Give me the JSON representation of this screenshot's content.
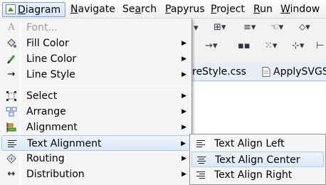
{
  "menubar": {
    "items": [
      {
        "label": "Diagram",
        "mnemonic": "D"
      },
      {
        "label": "Navigate",
        "mnemonic": "N"
      },
      {
        "label": "Search",
        "mnemonic": "a"
      },
      {
        "label": "Papyrus",
        "mnemonic": "P"
      },
      {
        "label": "Project",
        "mnemonic": "P"
      },
      {
        "label": "Run",
        "mnemonic": "R"
      },
      {
        "label": "Window",
        "mnemonic": "W"
      }
    ]
  },
  "background": {
    "tabs": [
      "reStyle.css",
      "ApplySVGS"
    ]
  },
  "menu": {
    "items": [
      {
        "label": "Font...",
        "icon": "font-icon",
        "disabled": true,
        "submenu": false
      },
      {
        "label": "Fill Color",
        "icon": "fill-color-icon",
        "disabled": false,
        "submenu": true
      },
      {
        "label": "Line Color",
        "icon": "line-color-icon",
        "disabled": false,
        "submenu": true
      },
      {
        "label": "Line Style",
        "icon": "line-style-icon",
        "disabled": false,
        "submenu": true
      },
      {
        "label": "Select",
        "icon": "select-icon",
        "disabled": false,
        "submenu": true
      },
      {
        "label": "Arrange",
        "icon": "arrange-icon",
        "disabled": false,
        "submenu": true
      },
      {
        "label": "Alignment",
        "icon": "alignment-icon",
        "disabled": false,
        "submenu": true
      },
      {
        "label": "Text Alignment",
        "icon": "text-alignment-icon",
        "disabled": false,
        "submenu": true,
        "highlighted": true
      },
      {
        "label": "Routing",
        "icon": "routing-icon",
        "disabled": false,
        "submenu": true
      },
      {
        "label": "Distribution",
        "icon": "distribution-icon",
        "disabled": false,
        "submenu": true
      }
    ]
  },
  "submenu": {
    "items": [
      {
        "label": "Text Align Left",
        "icon": "align-left-icon"
      },
      {
        "label": "Text Align Center",
        "icon": "align-center-icon",
        "highlighted": true
      },
      {
        "label": "Text Align Right",
        "icon": "align-right-icon"
      }
    ]
  },
  "colors": {
    "highlight_border": "#aecbf0",
    "menu_bg": "#f5f5f5",
    "disabled_text": "#9a9a9a"
  }
}
